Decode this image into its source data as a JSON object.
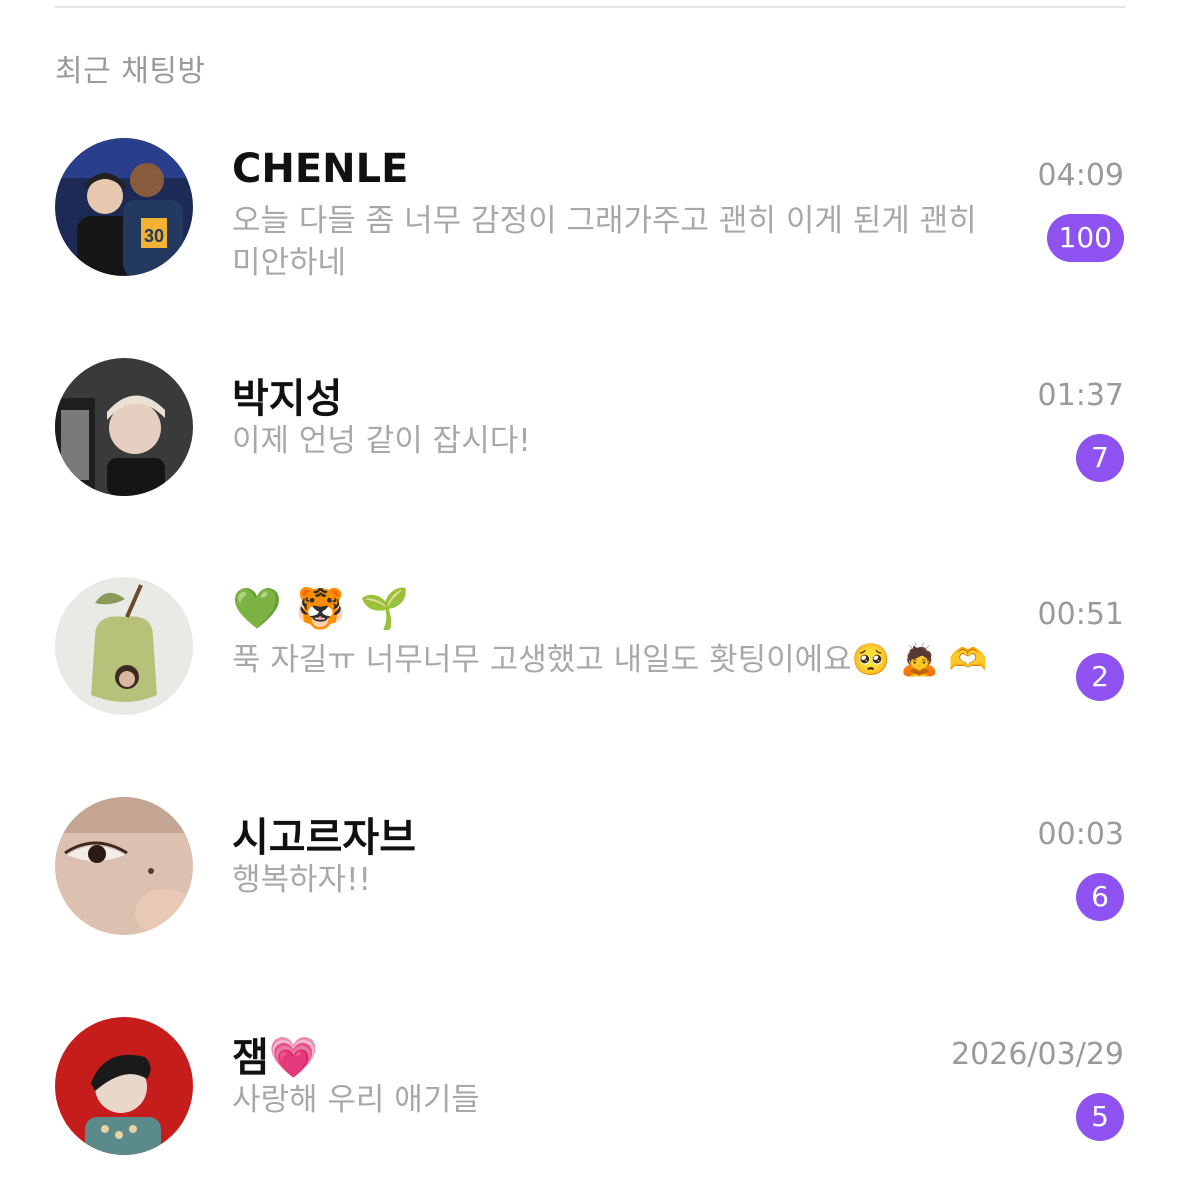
{
  "section_title": "최근 채팅방",
  "accent_color": "#8d52f0",
  "chats": [
    {
      "name": "CHENLE",
      "preview": "오늘 다들 좀 너무 감정이 그래가주고 괜히 이게 된게 괜히 미안하네",
      "time": "04:09",
      "unread": "100",
      "avatar_icon": "two-people-photo"
    },
    {
      "name": "박지성",
      "preview": "이제 언넝 같이 잡시다!",
      "time": "01:37",
      "unread": "7",
      "avatar_icon": "portrait-photo"
    },
    {
      "name": "💚 🐯 🌱",
      "preview": "푹 자길ㅠ 너무너무 고생했고 내일도 홧팅이에요🥺 🙇 🫶",
      "time": "00:51",
      "unread": "2",
      "avatar_icon": "apple-costume-photo"
    },
    {
      "name": "시고르자브",
      "preview": "행복하자!!",
      "time": "00:03",
      "unread": "6",
      "avatar_icon": "eye-closeup-photo"
    },
    {
      "name": "잼💗",
      "preview": "사랑해 우리 애기들",
      "time": "2026/03/29",
      "unread": "5",
      "avatar_icon": "red-background-portrait-photo"
    }
  ]
}
